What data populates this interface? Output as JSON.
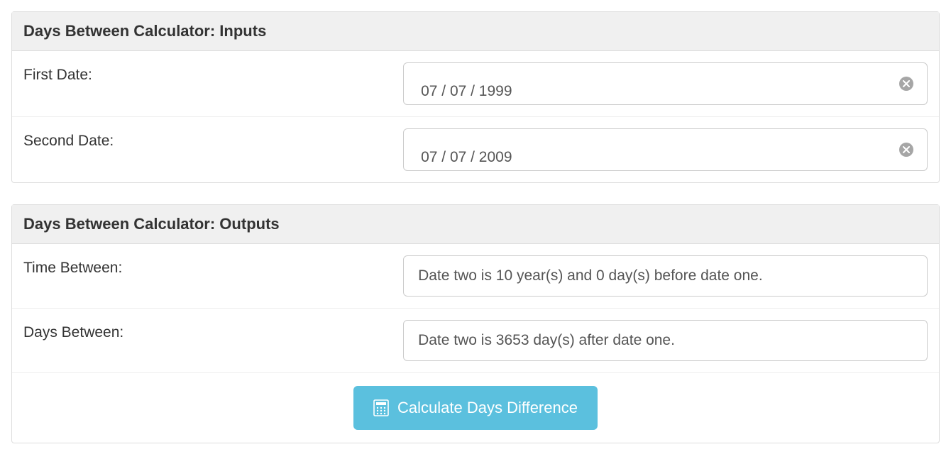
{
  "inputs": {
    "header": "Days Between Calculator: Inputs",
    "first_date_label": "First Date:",
    "first_date_value": "07 / 07 / 1999",
    "second_date_label": "Second Date:",
    "second_date_value": "07 / 07 / 2009"
  },
  "outputs": {
    "header": "Days Between Calculator: Outputs",
    "time_between_label": "Time Between:",
    "time_between_value": "Date two is 10 year(s) and 0 day(s) before date one.",
    "days_between_label": "Days Between:",
    "days_between_value": "Date two is 3653 day(s) after date one.",
    "button_label": "Calculate Days Difference"
  }
}
